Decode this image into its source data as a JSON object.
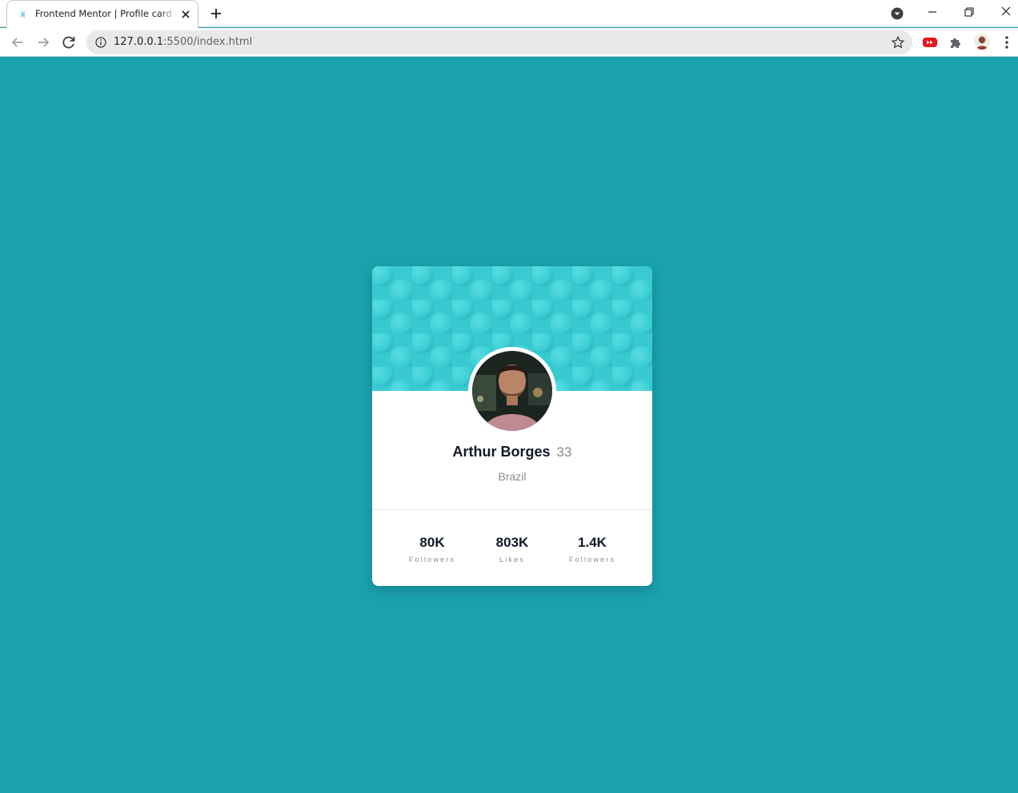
{
  "browser": {
    "tab": {
      "title": "Frontend Mentor | Profile card component"
    },
    "address_bar": {
      "host": "127.0.0.1",
      "path": ":5500/index.html"
    },
    "icons": [
      "back-arrow-icon",
      "forward-arrow-icon",
      "reload-icon",
      "info-icon",
      "star-icon",
      "youtube-extension-icon",
      "puzzle-icon",
      "profile-avatar-icon",
      "more-menu-icon",
      "minimize-icon",
      "restore-icon",
      "close-icon",
      "new-tab-icon",
      "tab-search-icon"
    ]
  },
  "profile_card": {
    "name": "Arthur Borges",
    "age": "33",
    "location": "Brazil",
    "stats": [
      {
        "value": "80K",
        "label": "Followers"
      },
      {
        "value": "803K",
        "label": "Likes"
      },
      {
        "value": "1.4K",
        "label": "Followers"
      }
    ]
  },
  "colors": {
    "page_background": "#19a2ae",
    "banner": "#3dcdd4",
    "card": "#ffffff",
    "text_primary": "#111827",
    "text_secondary": "#8a8a8a"
  }
}
